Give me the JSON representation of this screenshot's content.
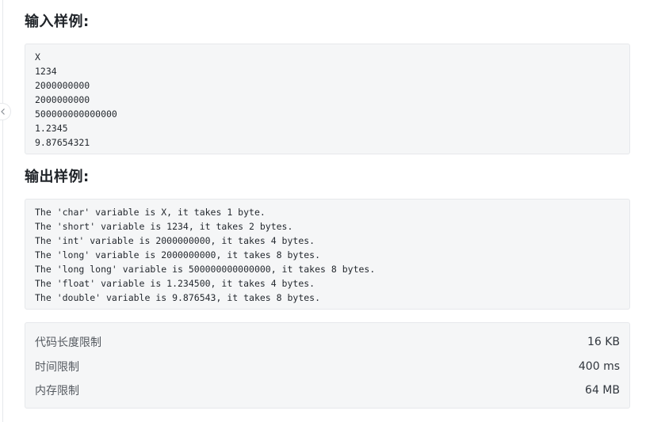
{
  "input_section": {
    "title": "输入样例:",
    "lines": [
      "X",
      "1234",
      "2000000000",
      "2000000000",
      "500000000000000",
      "1.2345",
      "9.87654321"
    ]
  },
  "output_section": {
    "title": "输出样例:",
    "lines": [
      "The 'char' variable is X, it takes 1 byte.",
      "The 'short' variable is 1234, it takes 2 bytes.",
      "The 'int' variable is 2000000000, it takes 4 bytes.",
      "The 'long' variable is 2000000000, it takes 8 bytes.",
      "The 'long long' variable is 500000000000000, it takes 8 bytes.",
      "The 'float' variable is 1.234500, it takes 4 bytes.",
      "The 'double' variable is 9.876543, it takes 8 bytes."
    ]
  },
  "limits": [
    {
      "label": "代码长度限制",
      "value": "16 KB"
    },
    {
      "label": "时间限制",
      "value": "400 ms"
    },
    {
      "label": "内存限制",
      "value": "64 MB"
    }
  ],
  "icons": {
    "collapse_handle": "chevron-left-icon"
  },
  "colors": {
    "code_background": "#f5f6f7",
    "border": "#e6e8eb",
    "heading_text": "#1f2328",
    "label_text": "#555a60"
  }
}
